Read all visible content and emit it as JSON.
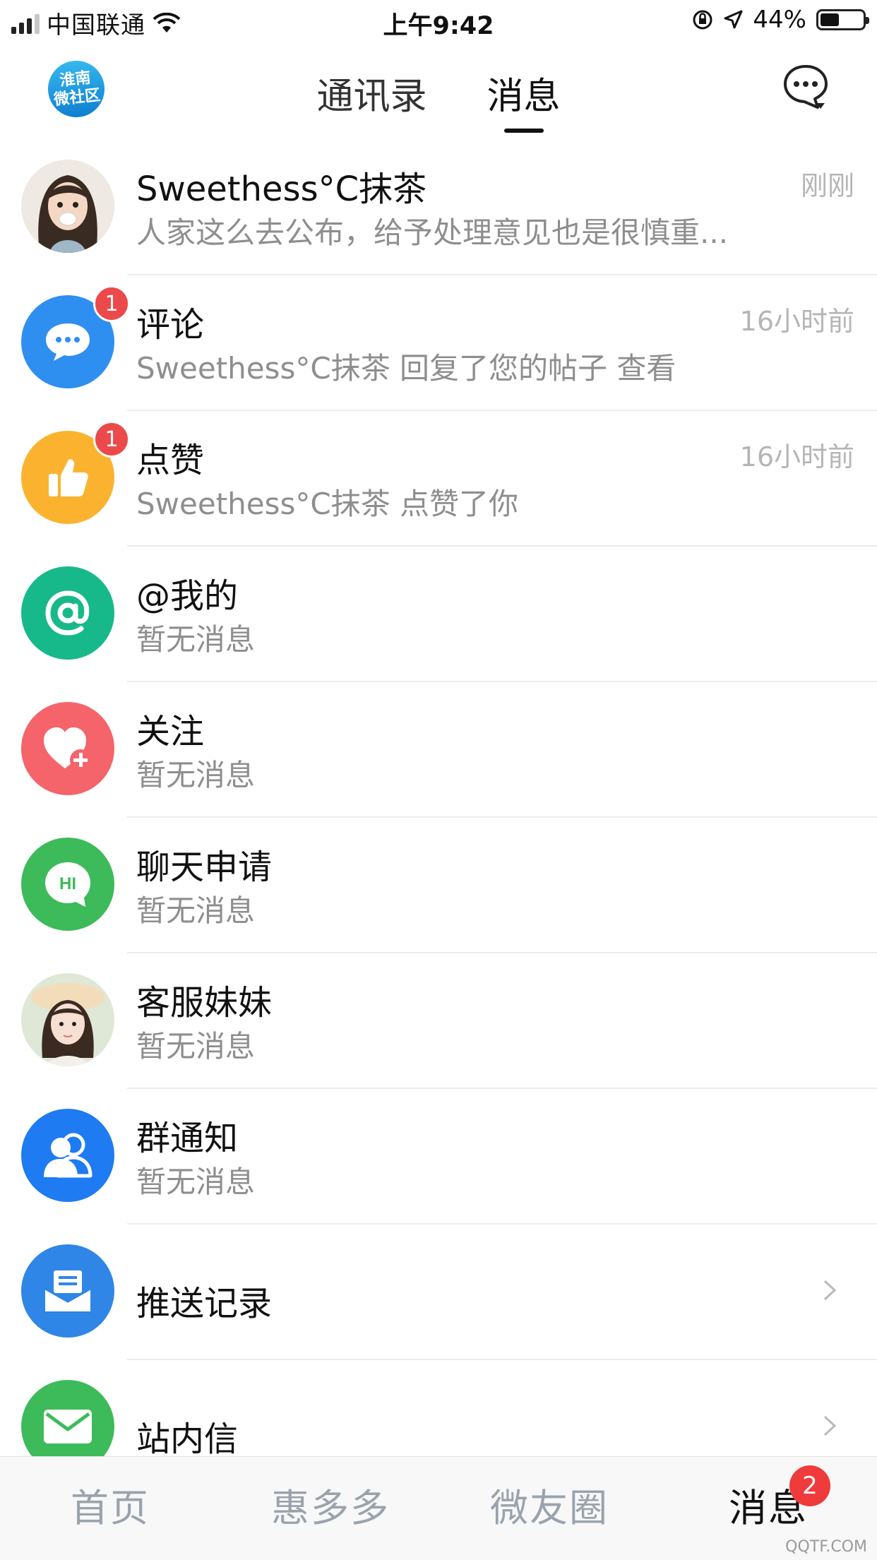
{
  "status_bar": {
    "carrier": "中国联通",
    "time": "上午9:42",
    "battery": "44%",
    "battery_level": 0.44
  },
  "header": {
    "logo_line1": "淮南",
    "logo_line2": "微社区",
    "tabs": [
      {
        "label": "通讯录",
        "active": false
      },
      {
        "label": "消息",
        "active": true
      }
    ]
  },
  "messages": [
    {
      "title": "Sweethess°C抹茶",
      "subtitle": "人家这么去公布，给予处理意见也是很慎重...",
      "time": "刚刚",
      "badge": "",
      "icon": "user-avatar-cartoon-girl"
    },
    {
      "title": "评论",
      "subtitle": "Sweethess°C抹茶 回复了您的帖子   查看",
      "time": "16小时前",
      "badge": "1",
      "icon": "comment-bubble-icon",
      "color": "#2f8ff0"
    },
    {
      "title": "点赞",
      "subtitle": "Sweethess°C抹茶 点赞了你",
      "time": "16小时前",
      "badge": "1",
      "icon": "thumbs-up-icon",
      "color": "#fbb32f"
    },
    {
      "title": "@我的",
      "subtitle": "暂无消息",
      "time": "",
      "badge": "",
      "icon": "at-sign-icon",
      "color": "#17b98a"
    },
    {
      "title": "关注",
      "subtitle": "暂无消息",
      "time": "",
      "badge": "",
      "icon": "heart-plus-icon",
      "color": "#f4646a"
    },
    {
      "title": "聊天申请",
      "subtitle": "暂无消息",
      "time": "",
      "badge": "",
      "icon": "hi-bubble-icon",
      "color": "#3dbb5a"
    },
    {
      "title": "客服妹妹",
      "subtitle": "暂无消息",
      "time": "",
      "badge": "",
      "icon": "support-avatar-photo"
    },
    {
      "title": "群通知",
      "subtitle": "暂无消息",
      "time": "",
      "badge": "",
      "icon": "group-users-icon",
      "color": "#1e7bf2"
    },
    {
      "title": "推送记录",
      "subtitle": "",
      "time": "",
      "badge": "",
      "icon": "push-inbox-icon",
      "color": "#2f86e6"
    },
    {
      "title": "站内信",
      "subtitle": "",
      "time": "",
      "badge": "",
      "icon": "mail-envelope-icon",
      "color": "#3dbb5a"
    }
  ],
  "tabbar": {
    "items": [
      "首页",
      "惠多多",
      "微友圈",
      "消息"
    ],
    "active_index": 3,
    "badge": "2"
  },
  "watermark": "QQTF.COM"
}
